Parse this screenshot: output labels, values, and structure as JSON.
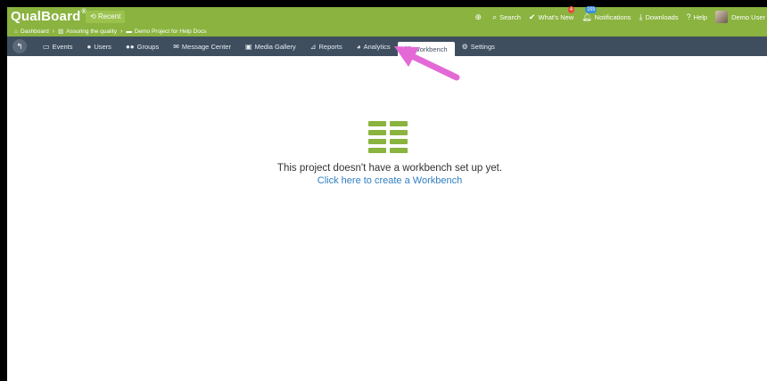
{
  "app": {
    "logo": "QualBoard",
    "logo_mark": "®",
    "recent_label": "Recent"
  },
  "top_right": {
    "search": "Search",
    "whats_new": "What's New",
    "whats_new_badge": "4",
    "notifications": "Notifications",
    "notifications_badge": "165",
    "downloads": "Downloads",
    "help": "Help",
    "user": "Demo User"
  },
  "breadcrumb": {
    "items": [
      "Dashboard",
      "Assuring the quality",
      "Demo Project for Help Docs"
    ]
  },
  "nav": {
    "items": [
      {
        "label": "Events",
        "icon": "calendar-icon"
      },
      {
        "label": "Users",
        "icon": "user-icon"
      },
      {
        "label": "Groups",
        "icon": "group-icon"
      },
      {
        "label": "Message Center",
        "icon": "envelope-icon"
      },
      {
        "label": "Media Gallery",
        "icon": "gallery-icon"
      },
      {
        "label": "Reports",
        "icon": "chart-icon"
      },
      {
        "label": "Analytics",
        "icon": "pie-icon"
      },
      {
        "label": "Workbench",
        "icon": "workbench-icon",
        "active": true
      },
      {
        "label": "Settings",
        "icon": "gear-icon"
      }
    ]
  },
  "main": {
    "empty_message": "This project doesn't have a workbench set up yet.",
    "create_link": "Click here to create a Workbench"
  },
  "colors": {
    "brand_green": "#8ab33f",
    "nav_dark": "#3f4e5e",
    "link_blue": "#2f7fc1",
    "annotation_arrow": "#e36ad6"
  }
}
